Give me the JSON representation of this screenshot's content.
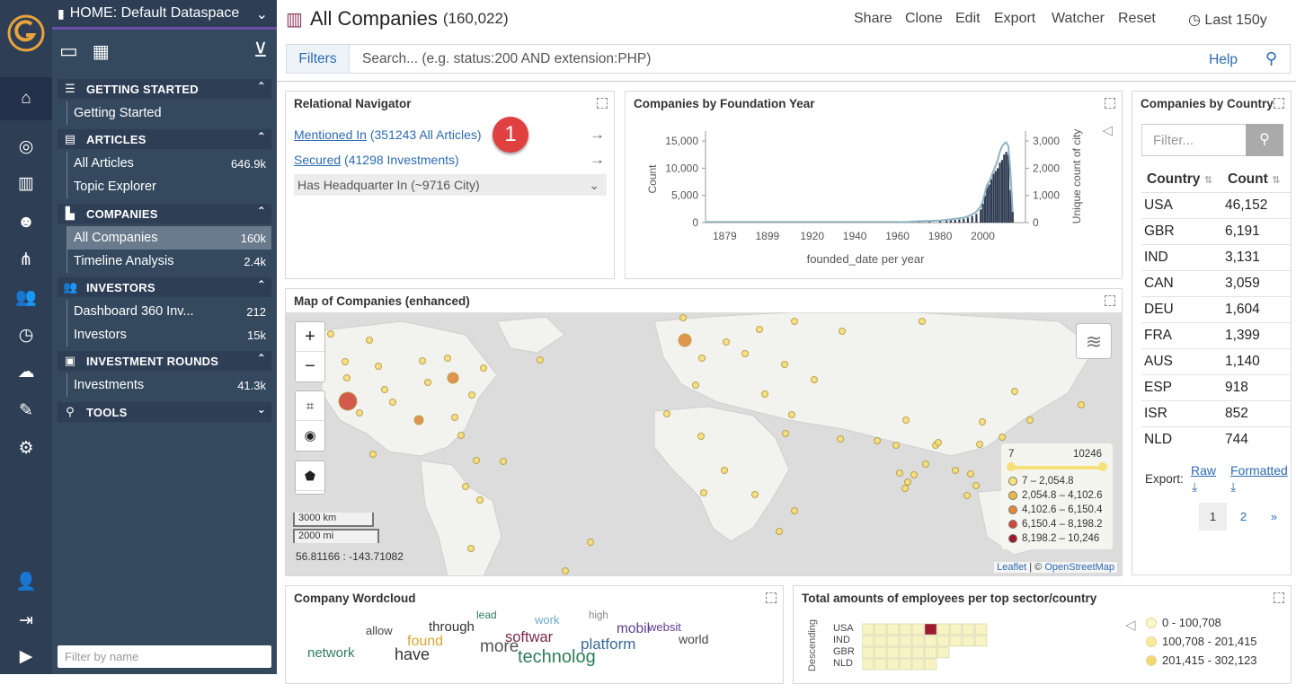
{
  "app": {
    "dataspace": "HOME: Default Dataspace"
  },
  "sidebar": {
    "sections": [
      {
        "title": "GETTING STARTED",
        "items": [
          {
            "label": "Getting Started",
            "count": ""
          }
        ]
      },
      {
        "title": "ARTICLES",
        "items": [
          {
            "label": "All Articles",
            "count": "646.9k"
          },
          {
            "label": "Topic Explorer",
            "count": ""
          }
        ]
      },
      {
        "title": "COMPANIES",
        "items": [
          {
            "label": "All Companies",
            "count": "160k"
          },
          {
            "label": "Timeline Analysis",
            "count": "2.4k"
          }
        ]
      },
      {
        "title": "INVESTORS",
        "items": [
          {
            "label": "Dashboard 360 Inv...",
            "count": "212"
          },
          {
            "label": "Investors",
            "count": "15k"
          }
        ]
      },
      {
        "title": "INVESTMENT ROUNDS",
        "items": [
          {
            "label": "Investments",
            "count": "41.3k"
          }
        ]
      },
      {
        "title": "TOOLS",
        "items": []
      }
    ],
    "filter_placeholder": "Filter by name"
  },
  "header": {
    "title": "All Companies",
    "count": "(160,022)",
    "actions": [
      "Share",
      "Clone",
      "Edit",
      "Export",
      "Watcher",
      "Reset"
    ],
    "time_range": "Last 150y"
  },
  "filterbar": {
    "filters_label": "Filters",
    "search_placeholder": "Search... (e.g. status:200 AND extension:PHP)",
    "help_label": "Help"
  },
  "relational": {
    "title": "Relational Navigator",
    "links": [
      {
        "label": "Mentioned In",
        "count": "(351243 All Articles)"
      },
      {
        "label": "Secured",
        "count": "(41298 Investments)"
      },
      {
        "label": "Has Headquarter In (~9716 City)",
        "count": ""
      }
    ],
    "badge": "1"
  },
  "chart_data": {
    "type": "bar",
    "title": "Companies by Foundation Year",
    "xlabel": "founded_date per year",
    "ylabel": "Count",
    "ylabel_right": "Unique count of city",
    "xticks": [
      "1879",
      "1899",
      "1920",
      "1940",
      "1960",
      "1980",
      "2000"
    ],
    "yticks": [
      "0",
      "5,000",
      "10,000",
      "15,000"
    ],
    "yticks_right": [
      "0",
      "1,000",
      "2,000",
      "3,000"
    ],
    "ylim": [
      0,
      16000
    ],
    "ylim_right": [
      0,
      3200
    ],
    "x": [
      1960,
      1965,
      1970,
      1975,
      1980,
      1983,
      1985,
      1987,
      1989,
      1991,
      1993,
      1995,
      1997,
      1999,
      2000,
      2001,
      2002,
      2003,
      2004,
      2005,
      2006,
      2007,
      2008,
      2009,
      2010,
      2011,
      2012,
      2013,
      2014
    ],
    "series": [
      {
        "values": [
          50,
          100,
          150,
          200,
          300,
          350,
          400,
          500,
          600,
          700,
          900,
          1200,
          1600,
          2400,
          3500,
          5000,
          6500,
          7000,
          8000,
          9000,
          9500,
          10000,
          11000,
          11500,
          12500,
          13000,
          12500,
          6000,
          2000
        ]
      },
      {
        "values": [
          20,
          30,
          50,
          60,
          80,
          100,
          120,
          140,
          160,
          180,
          230,
          300,
          400,
          600,
          800,
          1100,
          1400,
          1500,
          1700,
          1900,
          2100,
          2300,
          2600,
          2800,
          2900,
          2950,
          2800,
          1800,
          400
        ]
      }
    ]
  },
  "map": {
    "title": "Map of Companies (enhanced)",
    "scale_km": "3000 km",
    "scale_mi": "2000 mi",
    "coords": "56.81166 : -143.71082",
    "legend": {
      "min": "7",
      "max": "10246",
      "ranges": [
        "7 – 2,054.8",
        "2,054.8 – 4,102.6",
        "4,102.6 – 6,150.4",
        "6,150.4 – 8,198.2",
        "8,198.2 – 10,246"
      ],
      "colors": [
        "#f5e07a",
        "#e8b84a",
        "#e08a3c",
        "#cf4a3a",
        "#9e1a2e"
      ]
    },
    "attribution_leaflet": "Leaflet",
    "attribution_sep": "| ©",
    "attribution_osm": "OpenStreetMap"
  },
  "country_table": {
    "title": "Companies by Country",
    "filter_placeholder": "Filter...",
    "col_country": "Country",
    "col_count": "Count",
    "rows": [
      [
        "USA",
        "46,152"
      ],
      [
        "GBR",
        "6,191"
      ],
      [
        "IND",
        "3,131"
      ],
      [
        "CAN",
        "3,059"
      ],
      [
        "DEU",
        "1,604"
      ],
      [
        "FRA",
        "1,399"
      ],
      [
        "AUS",
        "1,140"
      ],
      [
        "ESP",
        "918"
      ],
      [
        "ISR",
        "852"
      ],
      [
        "NLD",
        "744"
      ]
    ],
    "export_label": "Export:",
    "raw_label": "Raw",
    "formatted_label": "Formatted",
    "pages": [
      "1",
      "2",
      "»"
    ]
  },
  "wordcloud": {
    "title": "Company Wordcloud",
    "words": [
      "lead",
      "work",
      "high",
      "allow",
      "through",
      "mobil",
      "websit",
      "found",
      "softwar",
      "world",
      "more",
      "platform",
      "network",
      "have",
      "technolog"
    ]
  },
  "heatmap": {
    "title": "Total amounts of employees per top sector/country",
    "axis_label": "Descending",
    "rows": [
      "USA",
      "IND",
      "GBR",
      "NLD"
    ],
    "legend": [
      "0 - 100,708",
      "100,708 - 201,415",
      "201,415 - 302,123"
    ]
  }
}
